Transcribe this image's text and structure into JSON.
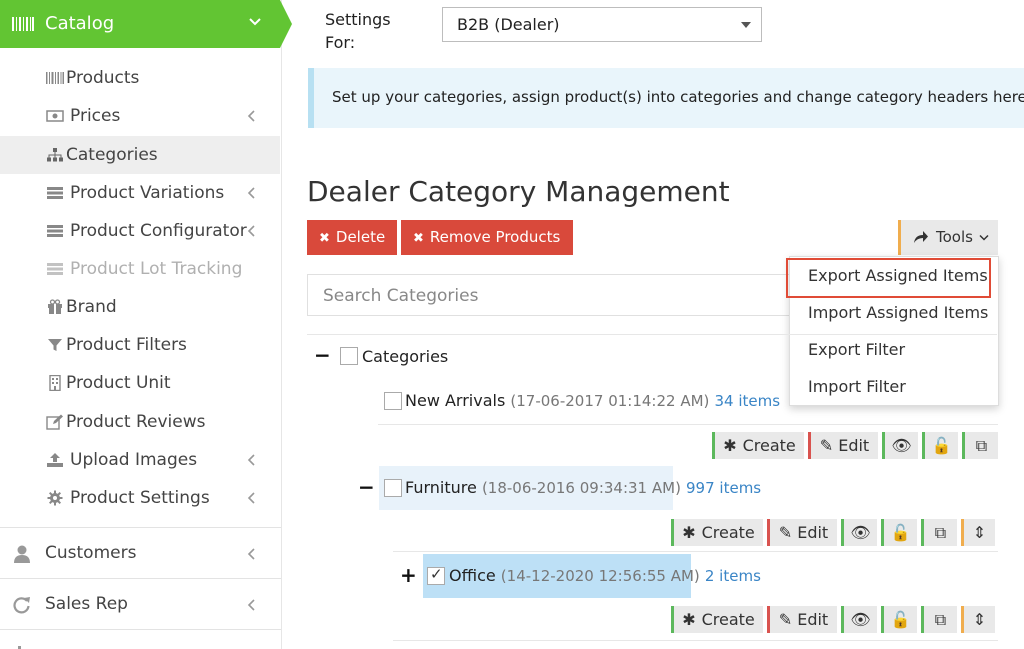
{
  "sidebar": {
    "header_label": "Catalog",
    "items": [
      {
        "label": "Products",
        "icon": "barcode-icon"
      },
      {
        "label": "Prices",
        "icon": "money-icon"
      },
      {
        "label": "Categories",
        "icon": "sitemap-icon"
      },
      {
        "label": "Product Variations",
        "icon": "list-icon"
      },
      {
        "label": "Product Configurator",
        "icon": "list-icon"
      },
      {
        "label": "Product Lot Tracking",
        "icon": "list-icon"
      },
      {
        "label": "Brand",
        "icon": "gift-icon"
      },
      {
        "label": "Product Filters",
        "icon": "filter-icon"
      },
      {
        "label": "Product Unit",
        "icon": "building-icon"
      },
      {
        "label": "Product Reviews",
        "icon": "edit-icon"
      },
      {
        "label": "Upload Images",
        "icon": "upload-icon"
      },
      {
        "label": "Product Settings",
        "icon": "gear-icon"
      }
    ],
    "major": [
      {
        "label": "Customers",
        "icon": "user-icon"
      },
      {
        "label": "Sales Rep",
        "icon": "refresh-icon"
      }
    ]
  },
  "settings": {
    "label_line1": "Settings",
    "label_line2": "For:",
    "selected": "B2B (Dealer)"
  },
  "banner": "Set up your categories, assign product(s) into categories and change category headers here.",
  "title": "Dealer Category Management",
  "toolbar": {
    "delete": "Delete",
    "remove_products": "Remove Products",
    "tools": "Tools"
  },
  "search": {
    "placeholder": "Search Categories"
  },
  "tools_menu": [
    "Export Assigned Items",
    "Import Assigned Items",
    "Export Filter",
    "Import Filter"
  ],
  "tree": {
    "root": "Categories",
    "nodes": [
      {
        "name": "New Arrivals",
        "date": "(17-06-2017 01:14:22 AM)",
        "count": "34 items"
      },
      {
        "name": "Furniture",
        "date": "(18-06-2016 09:34:31 AM)",
        "count": "997 items"
      },
      {
        "name": "Office",
        "date": "(14-12-2020 12:56:55 AM)",
        "count": "2 items"
      }
    ],
    "actions": {
      "create": "Create",
      "edit": "Edit"
    }
  },
  "colors": {
    "accent_green": "#62c533",
    "danger": "#d9493b",
    "highlight": "#e04b36",
    "link": "#3a85c6"
  }
}
